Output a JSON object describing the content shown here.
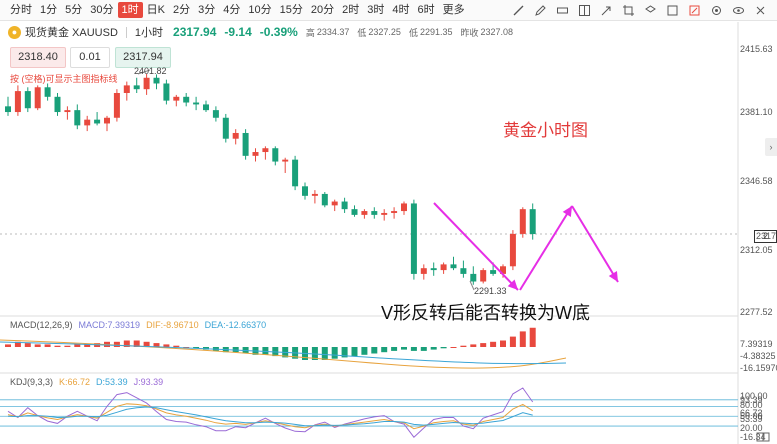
{
  "toolbar": {
    "periods": [
      "分时",
      "1分",
      "5分",
      "30分",
      "1时",
      "日K",
      "2分",
      "3分",
      "4分",
      "10分",
      "15分",
      "20分",
      "2时",
      "3时",
      "4时",
      "6时",
      "更多"
    ],
    "active_period": 4,
    "tool_icons": [
      "draw-line-icon",
      "pen-icon",
      "ruler-icon",
      "grid-icon",
      "arrow-icon",
      "crop-icon",
      "layers-icon",
      "hide-icon",
      "edit-icon",
      "settings-icon",
      "eye-icon",
      "close-icon"
    ]
  },
  "instrument": {
    "name": "现货黄金 XAUUSD",
    "timeframe": "1小时",
    "price": "2317.94",
    "change": "-9.14",
    "change_pct": "-0.39%",
    "high_label": "高",
    "high": "2334.37",
    "low_label": "低",
    "low": "2327.25",
    "last_label": "低",
    "last": "2291.35",
    "prev_close_label": "昨收",
    "prev_close": "2327.08"
  },
  "order": {
    "sell": "2318.40",
    "qty": "0.01",
    "buy": "2317.94",
    "hint": "按 (空格)可显示主图指标线"
  },
  "colors": {
    "up": "#e8493e",
    "down": "#19a07a",
    "annotation": "#e62ee6"
  },
  "chart_data": {
    "type": "candlestick",
    "price_axis_ticks": [
      "2415.63",
      "2381.10",
      "2346.58",
      "2312.05",
      "2277.52"
    ],
    "ylim": [
      2277.52,
      2415.63
    ],
    "high_marker": "2401.82",
    "low_marker": "2291.33",
    "current_tag": "2",
    "current_value": "2317.94",
    "candles": [
      [
        2385,
        2390,
        2380,
        2382
      ],
      [
        2382,
        2396,
        2380,
        2393
      ],
      [
        2393,
        2395,
        2382,
        2384
      ],
      [
        2384,
        2396,
        2383,
        2395
      ],
      [
        2395,
        2397,
        2388,
        2390
      ],
      [
        2390,
        2392,
        2380,
        2382
      ],
      [
        2382,
        2385,
        2378,
        2383
      ],
      [
        2383,
        2386,
        2373,
        2375
      ],
      [
        2375,
        2380,
        2372,
        2378
      ],
      [
        2378,
        2382,
        2375,
        2376
      ],
      [
        2376,
        2380,
        2372,
        2379
      ],
      [
        2379,
        2394,
        2377,
        2392
      ],
      [
        2392,
        2398,
        2388,
        2396
      ],
      [
        2396,
        2400,
        2392,
        2394
      ],
      [
        2394,
        2402,
        2391,
        2400
      ],
      [
        2400,
        2401.8,
        2394,
        2397
      ],
      [
        2397,
        2399,
        2386,
        2388
      ],
      [
        2388,
        2391,
        2385,
        2390
      ],
      [
        2390,
        2392,
        2385,
        2387
      ],
      [
        2387,
        2390,
        2383,
        2386
      ],
      [
        2386,
        2388,
        2382,
        2383
      ],
      [
        2383,
        2385,
        2377,
        2379
      ],
      [
        2379,
        2381,
        2366,
        2368
      ],
      [
        2368,
        2373,
        2365,
        2371
      ],
      [
        2371,
        2373,
        2357,
        2359
      ],
      [
        2359,
        2363,
        2356,
        2361
      ],
      [
        2361,
        2364,
        2357,
        2363
      ],
      [
        2363,
        2364,
        2354,
        2356
      ],
      [
        2356,
        2358,
        2350,
        2357
      ],
      [
        2357,
        2359,
        2341,
        2343
      ],
      [
        2343,
        2345,
        2336,
        2338
      ],
      [
        2338,
        2341,
        2334,
        2339
      ],
      [
        2339,
        2340,
        2332,
        2333
      ],
      [
        2333,
        2336,
        2330,
        2335
      ],
      [
        2335,
        2337,
        2329,
        2331
      ],
      [
        2331,
        2333,
        2327,
        2328
      ],
      [
        2328,
        2331,
        2326,
        2330
      ],
      [
        2330,
        2332,
        2326,
        2328
      ],
      [
        2328,
        2331,
        2325,
        2329
      ],
      [
        2329,
        2332,
        2326,
        2330
      ],
      [
        2330,
        2335,
        2328,
        2334
      ],
      [
        2334,
        2336,
        2294,
        2297
      ],
      [
        2297,
        2302,
        2294,
        2300
      ],
      [
        2300,
        2303,
        2296,
        2299
      ],
      [
        2299,
        2303,
        2297,
        2302
      ],
      [
        2302,
        2306,
        2299,
        2300
      ],
      [
        2300,
        2304,
        2295,
        2297
      ],
      [
        2297,
        2301,
        2291.3,
        2293
      ],
      [
        2293,
        2300,
        2292,
        2299
      ],
      [
        2299,
        2303,
        2296,
        2297
      ],
      [
        2297,
        2302,
        2295,
        2301
      ],
      [
        2301,
        2320,
        2299,
        2318
      ],
      [
        2318,
        2332,
        2316,
        2331
      ],
      [
        2331,
        2334,
        2315,
        2317.94
      ]
    ]
  },
  "annotations": {
    "title": "黄金小时图",
    "main": "V形反转后能否转换为W底"
  },
  "macd": {
    "title": "MACD(12,26,9)",
    "macd": "MACD:7.39319",
    "dif": "DIF:-8.96710",
    "dea": "DEA:-12.66370",
    "ticks": [
      "7.39319",
      "-4.38325",
      "-16.15970"
    ],
    "bars": [
      1,
      2,
      1.5,
      1,
      1,
      0.5,
      0.5,
      1,
      1,
      1.5,
      2,
      2,
      2.5,
      2.5,
      2,
      1.5,
      1,
      0.5,
      0,
      -0.5,
      -1,
      -1.5,
      -2,
      -2,
      -2.5,
      -3,
      -3,
      -3.5,
      -4,
      -4.5,
      -5,
      -5,
      -5,
      -4.5,
      -4,
      -3.5,
      -3,
      -2.5,
      -2,
      -1.5,
      -1,
      -1.5,
      -1.5,
      -1,
      -0.5,
      0,
      0.5,
      1,
      1.5,
      2,
      2.5,
      4,
      6,
      7.4
    ]
  },
  "kdj": {
    "title": "KDJ(9,3,3)",
    "k": "K:66.72",
    "d": "D:53.39",
    "j": "J:93.39",
    "ticks": [
      "100.00",
      "80.00",
      "50.00",
      "20.00",
      "-16.34"
    ],
    "overlap_ticks": [
      "93.39",
      "66.72",
      "53.39"
    ],
    "tick_values": [
      100,
      80,
      50,
      20,
      -16.34
    ],
    "k_values": [
      55,
      48,
      60,
      52,
      45,
      40,
      48,
      55,
      50,
      44,
      62,
      80,
      88,
      86,
      82,
      72,
      60,
      54,
      50,
      44,
      38,
      30,
      26,
      28,
      25,
      30,
      36,
      30,
      24,
      18,
      15,
      22,
      26,
      20,
      24,
      28,
      32,
      36,
      40,
      34,
      30,
      12,
      20,
      30,
      34,
      36,
      26,
      22,
      34,
      40,
      46,
      72,
      86,
      66.72
    ],
    "d_values": [
      50,
      49,
      52,
      52,
      50,
      46,
      47,
      50,
      50,
      48,
      53,
      62,
      71,
      76,
      78,
      76,
      70,
      64,
      59,
      54,
      48,
      42,
      36,
      33,
      30,
      30,
      32,
      31,
      29,
      25,
      21,
      21,
      23,
      22,
      23,
      25,
      27,
      30,
      34,
      34,
      32,
      25,
      23,
      25,
      28,
      31,
      29,
      27,
      29,
      33,
      37,
      49,
      61,
      53.39
    ],
    "j_values": [
      65,
      46,
      76,
      52,
      35,
      28,
      50,
      65,
      50,
      36,
      80,
      116,
      122,
      106,
      90,
      64,
      40,
      34,
      32,
      24,
      18,
      6,
      6,
      18,
      15,
      30,
      44,
      28,
      14,
      4,
      3,
      24,
      32,
      16,
      26,
      34,
      42,
      48,
      52,
      34,
      26,
      -14,
      14,
      40,
      46,
      46,
      20,
      12,
      44,
      54,
      64,
      118,
      136,
      93.39
    ]
  }
}
